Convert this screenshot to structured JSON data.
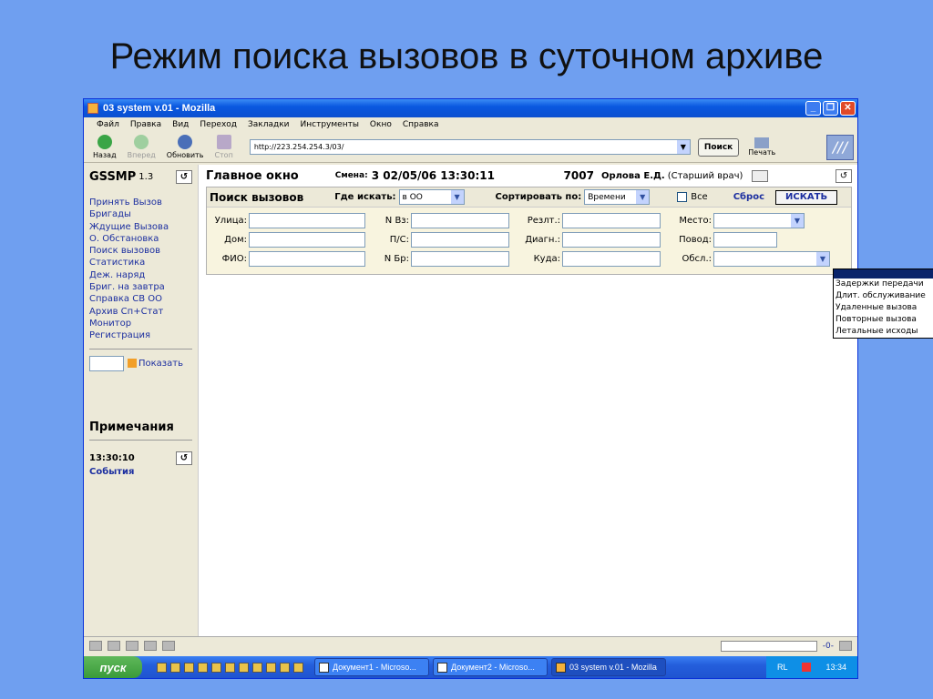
{
  "slide_title": "Режим поиска вызовов в суточном архиве",
  "window": {
    "title": "03 system v.01 - Mozilla",
    "minimize": "_",
    "maximize": "❐",
    "close": "✕"
  },
  "menu": [
    "Файл",
    "Правка",
    "Вид",
    "Переход",
    "Закладки",
    "Инструменты",
    "Окно",
    "Справка"
  ],
  "toolbar": {
    "back": "Назад",
    "forward": "Вперед",
    "reload": "Обновить",
    "stop": "Стоп",
    "url": "http://223.254.254.3/03/",
    "search": "Поиск",
    "print": "Печать"
  },
  "sidebar": {
    "app_name": "GSSMP",
    "version": "1.3",
    "items": [
      "Принять Вызов",
      "Бригады",
      "Ждущие Вызова",
      "О. Обстановка",
      "Поиск вызовов",
      "Статистика",
      "Деж. наряд",
      "Бриг. на завтра",
      "Справка СВ ОО",
      "Архив Сп+Стат",
      "Монитор",
      "Регистрация"
    ],
    "show_label": "Показать",
    "notes_title": "Примечания",
    "notes_time": "13:30:10",
    "events_label": "События"
  },
  "header": {
    "title": "Главное окно",
    "shift_label": "Смена:",
    "shift_value": "3  02/05/06  13:30:11",
    "user_num": "7007",
    "user_name": "Орлова Е.Д.",
    "user_role": "(Старший врач)"
  },
  "search": {
    "title": "Поиск вызовов",
    "where_label": "Где искать:",
    "where_value": "в ОО",
    "sort_label": "Сортировать по:",
    "sort_value": "Времени",
    "all_label": "Все",
    "reset_label": "Сброс",
    "find_label": "ИСКАТЬ",
    "fields": {
      "street": "Улица:",
      "house": "Дом:",
      "fio": "ФИО:",
      "num_vz": "N Вз:",
      "ps": "П/С:",
      "num_br": "N Бр:",
      "result": "Резлт.:",
      "diag": "Диагн.:",
      "where_to": "Куда:",
      "place": "Место:",
      "reason": "Повод:",
      "service": "Обсл.:"
    },
    "service_options": [
      "Задержки передачи",
      "Длит. обслуживание",
      "Удаленные вызова",
      "Повторные вызова",
      "Летальные исходы"
    ]
  },
  "taskbar": {
    "start": "пуск",
    "tasks": [
      "Документ1 - Microso...",
      "Документ2 - Microso...",
      "03 system v.01 - Mozilla"
    ],
    "lang": "RL",
    "clock": "13:34"
  }
}
